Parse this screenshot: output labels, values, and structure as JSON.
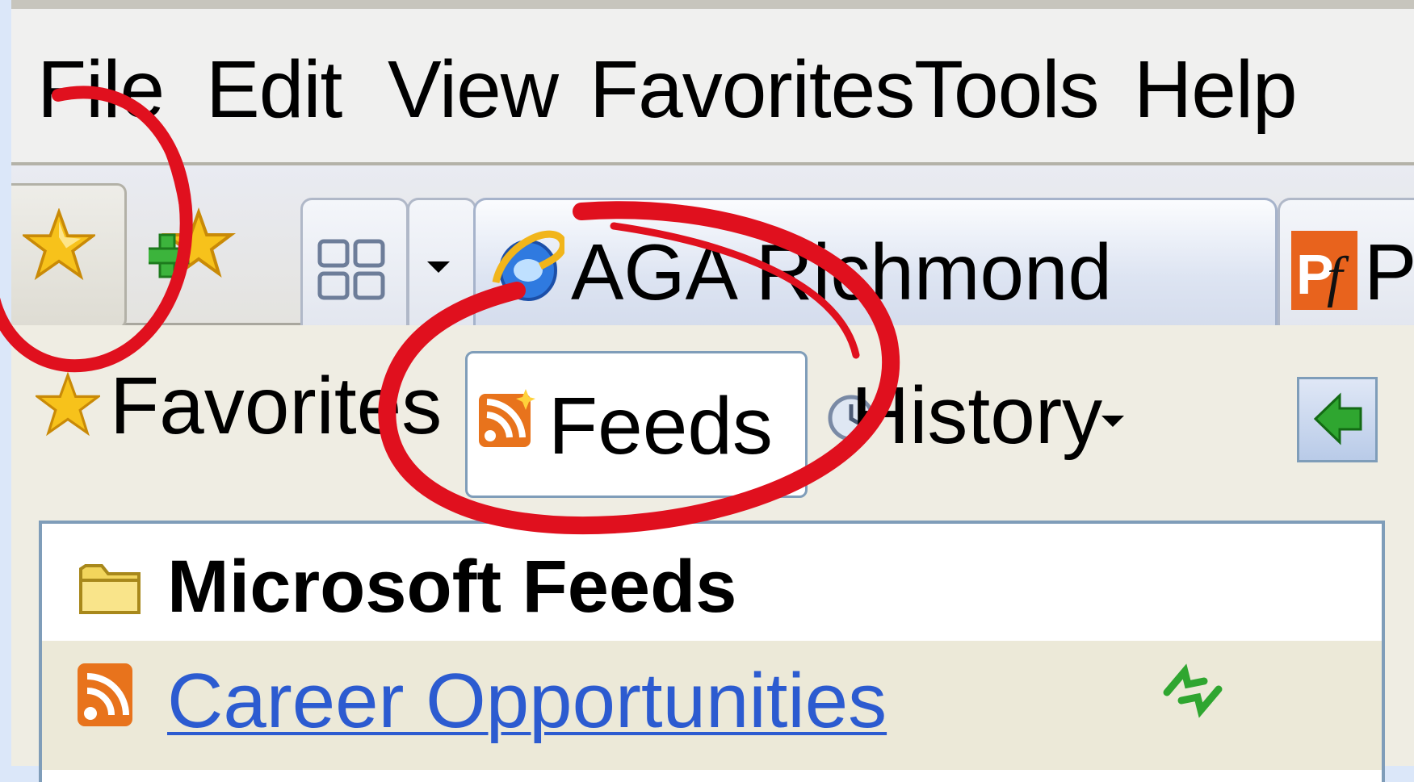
{
  "menu": [
    "File",
    "Edit",
    "View",
    "Favorites",
    "Tools",
    "Help"
  ],
  "tabs": {
    "active_label": "AGA Richmond",
    "second_label": "P"
  },
  "panel": {
    "favorites_label": "Favorites",
    "feeds_label": "Feeds",
    "history_label": "History"
  },
  "list": {
    "folder_label": "Microsoft Feeds",
    "feed_label": "Career Opportunities"
  },
  "colors": {
    "annotation": "#e0101e",
    "link": "#2c5bd0",
    "feed_orange": "#e8731c"
  },
  "icons": {
    "favorites_center": "star-icon",
    "add_favorite": "add-star-icon",
    "quick_tabs": "quick-tabs-icon",
    "ie_page": "ie-logo-icon",
    "feeds": "rss-icon",
    "history": "history-icon",
    "pin": "green-arrow-icon",
    "folder": "folder-icon",
    "refresh": "refresh-icon"
  }
}
